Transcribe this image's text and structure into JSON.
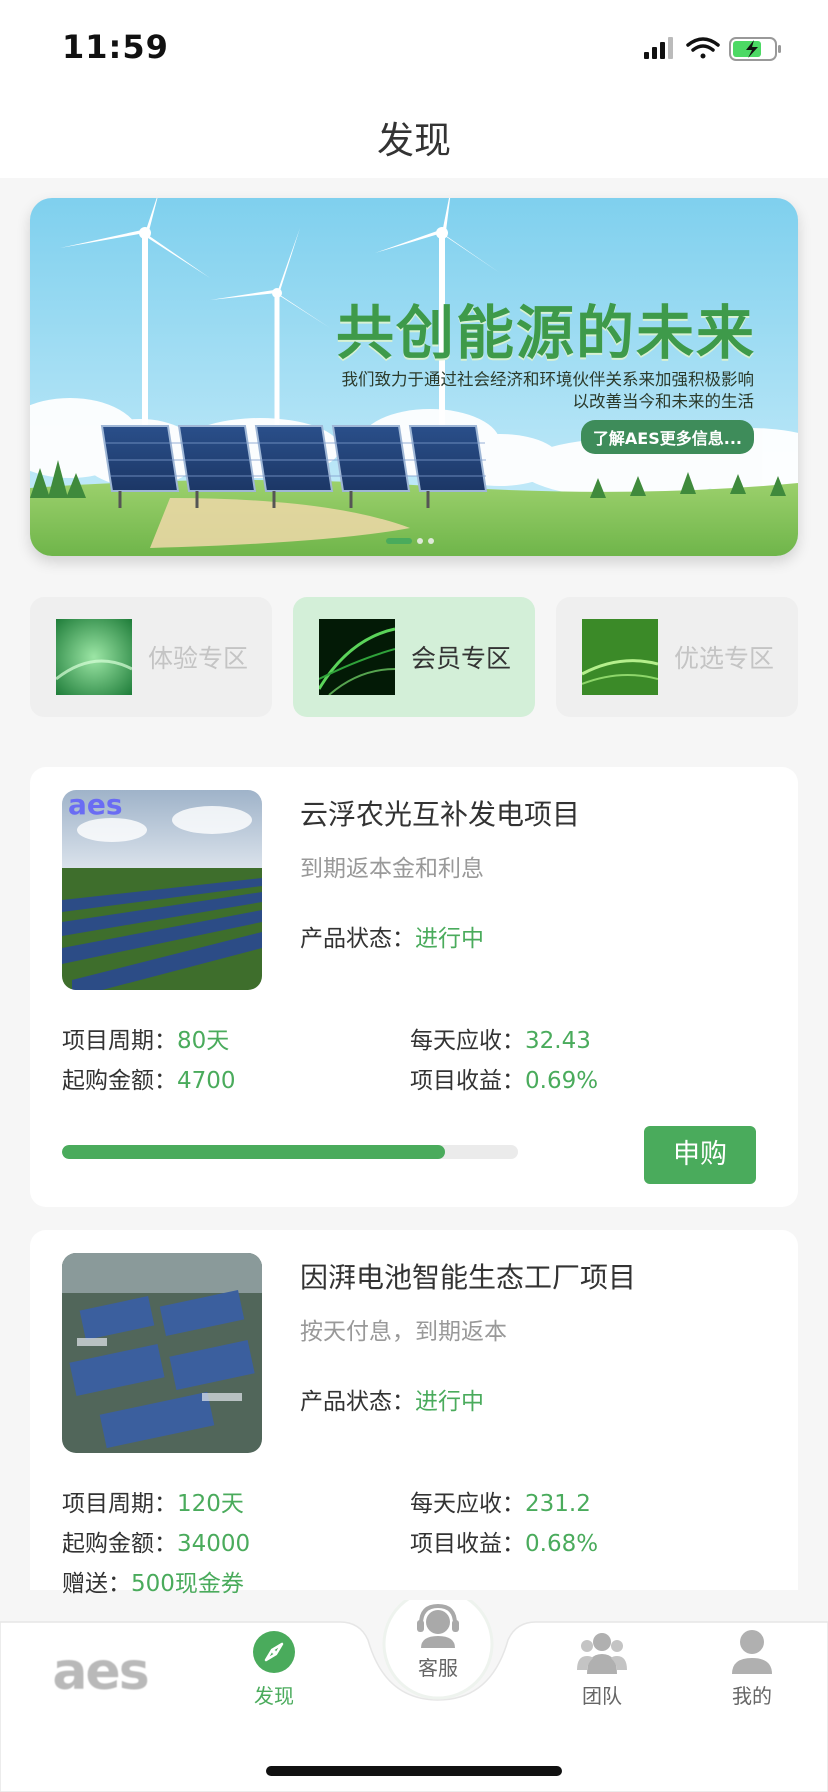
{
  "status_bar": {
    "time": "11:59"
  },
  "header": {
    "title": "发现"
  },
  "banner": {
    "headline": "共创能源的未来",
    "subtitle_line1": "我们致力于通过社会经济和环境伙伴关系来加强积极影响",
    "subtitle_line2": "以改善当今和未来的生活",
    "button_label": "了解AES更多信息...",
    "active_dot": 0,
    "dot_count": 3
  },
  "zones": [
    {
      "label": "体验专区",
      "active": false
    },
    {
      "label": "会员专区",
      "active": true
    },
    {
      "label": "优选专区",
      "active": false
    }
  ],
  "projects": [
    {
      "title": "云浮农光互补发电项目",
      "description": "到期返本金和利息",
      "status_label": "产品状态：",
      "status_value": "进行中",
      "period_label": "项目周期：",
      "period_value": "80天",
      "daily_label": "每天应收：",
      "daily_value": "32.43",
      "min_label": "起购金额：",
      "min_value": "4700",
      "yield_label": "项目收益：",
      "yield_value": "0.69%",
      "progress": 0.84,
      "button_label": "申购",
      "image_watermark": "aes"
    },
    {
      "title": "因湃电池智能生态工厂项目",
      "description": "按天付息，到期返本",
      "status_label": "产品状态：",
      "status_value": "进行中",
      "period_label": "项目周期：",
      "period_value": "120天",
      "daily_label": "每天应收：",
      "daily_value": "231.2",
      "min_label": "起购金额：",
      "min_value": "34000",
      "yield_label": "项目收益：",
      "yield_value": "0.68%",
      "gift_label": "赠送：",
      "gift_value": "500现金券"
    }
  ],
  "tabbar": {
    "logo_text": "aes",
    "items": [
      {
        "label": "发现",
        "icon": "compass-icon",
        "active": true
      },
      {
        "label": "客服",
        "icon": "headset-icon",
        "active": false
      },
      {
        "label": "团队",
        "icon": "team-icon",
        "active": false
      },
      {
        "label": "我的",
        "icon": "user-icon",
        "active": false
      }
    ]
  },
  "colors": {
    "accent": "#4aab5c",
    "accent_light": "#d3efd8",
    "text": "#333333",
    "muted": "#999999"
  }
}
